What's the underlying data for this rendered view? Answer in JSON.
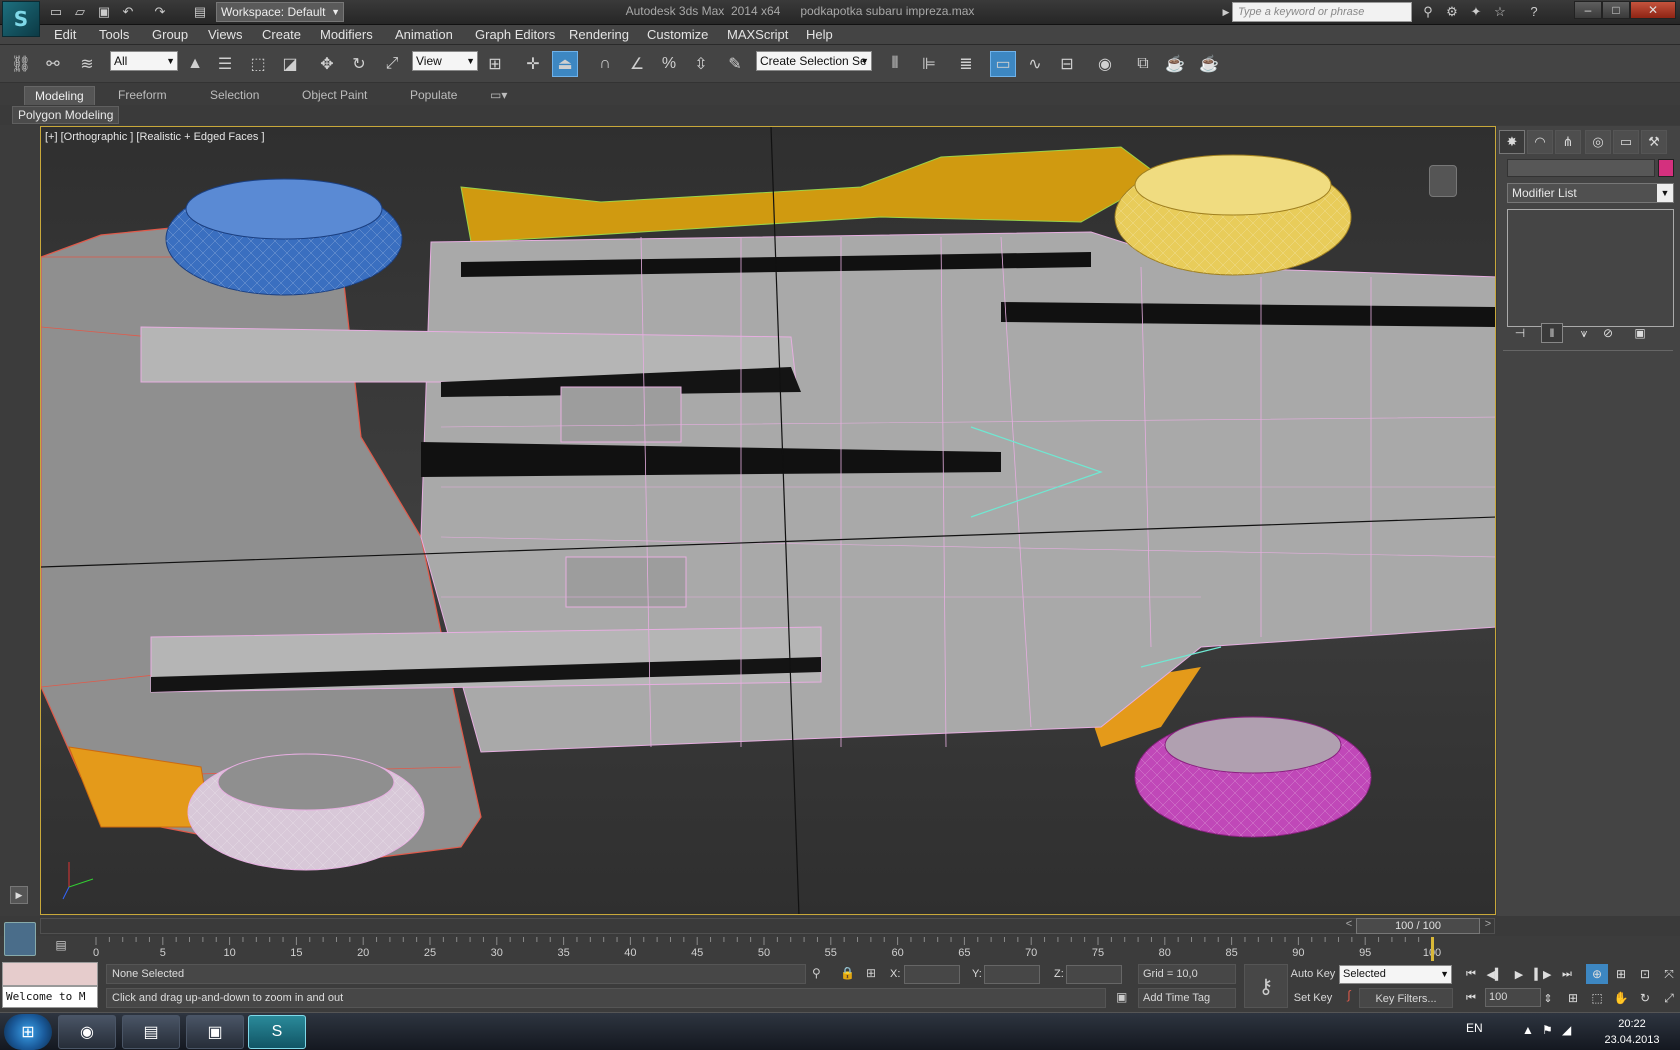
{
  "titlebar": {
    "workspace": "Workspace: Default",
    "title": "Autodesk 3ds Max  2014 x64      podkapotka subaru impreza.max",
    "search_placeholder": "Type a keyword or phrase"
  },
  "menu": [
    "Edit",
    "Tools",
    "Group",
    "Views",
    "Create",
    "Modifiers",
    "Animation",
    "Graph Editors",
    "Rendering",
    "Customize",
    "MAXScript",
    "Help"
  ],
  "toolbar": {
    "selection_filter": "All",
    "ref_coord": "View",
    "named_selection": "Create Selection Se"
  },
  "ribbon": {
    "tabs": [
      "Modeling",
      "Freeform",
      "Selection",
      "Object Paint",
      "Populate"
    ],
    "active_tab": "Modeling",
    "panel": "Polygon Modeling"
  },
  "viewport": {
    "label": "[+] [Orthographic ] [Realistic + Edged Faces ]"
  },
  "command_panel": {
    "modifier_list": "Modifier List",
    "object_color": "#d4307e"
  },
  "time": {
    "frame_display": "100 / 100",
    "ticks": [
      "0",
      "5",
      "10",
      "15",
      "20",
      "25",
      "30",
      "35",
      "40",
      "45",
      "50",
      "55",
      "60",
      "65",
      "70",
      "75",
      "80",
      "85",
      "90",
      "95",
      "100"
    ]
  },
  "status": {
    "selection": "None Selected",
    "prompt": "Click and drag up-and-down to zoom in and out",
    "maxscript_text": "Welcome to M",
    "x_label": "X:",
    "y_label": "Y:",
    "z_label": "Z:",
    "grid": "Grid = 10,0",
    "add_time_tag": "Add Time Tag",
    "auto_key": "Auto Key",
    "set_key": "Set Key",
    "key_mode": "Selected",
    "key_filters": "Key Filters...",
    "current_frame": "100"
  },
  "taskbar": {
    "language": "EN",
    "time": "20:22",
    "date": "23.04.2013"
  }
}
